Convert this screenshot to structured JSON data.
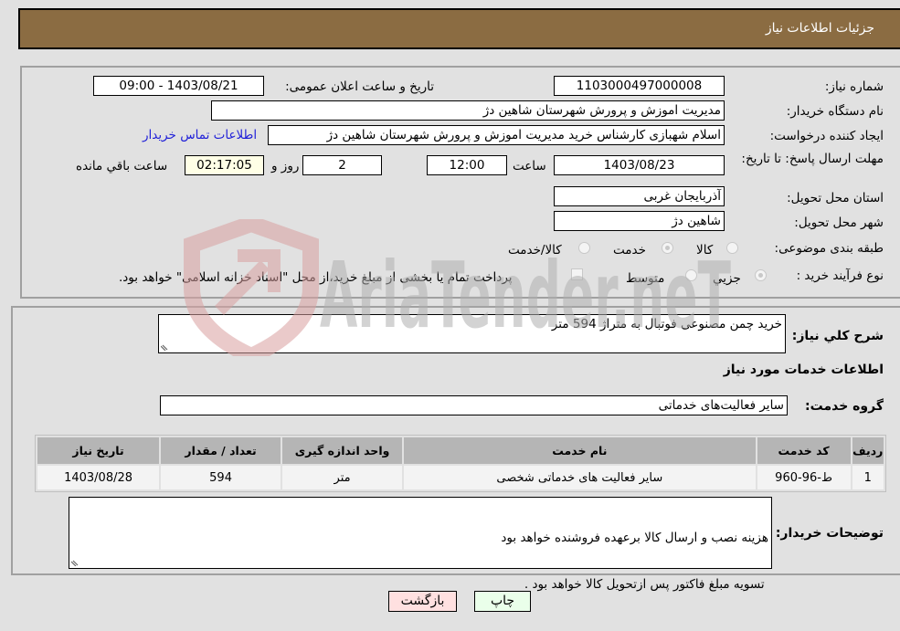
{
  "header": {
    "title": "جزئیات اطلاعات نیاز"
  },
  "details": {
    "need_number_label": "شماره نیاز:",
    "need_number": "1103000497000008",
    "announce_label": "تاریخ و ساعت اعلان عمومی:",
    "announce_value": "1403/08/21 - 09:00",
    "buyer_org_label": "نام دستگاه خریدار:",
    "buyer_org": "مدیریت اموزش و پرورش شهرستان شاهین دژ",
    "creator_label": "ایجاد کننده درخواست:",
    "creator": "اسلام شهبازی کارشناس خرید مدیریت اموزش و پرورش شهرستان شاهین دژ",
    "contact_link": "اطلاعات تماس خریدار",
    "deadline_label": "مهلت ارسال پاسخ: تا تاریخ:",
    "deadline_date": "1403/08/23",
    "time_label": "ساعت",
    "deadline_time": "12:00",
    "days_value": "2",
    "days_label": "روز و",
    "remaining_time": "02:17:05",
    "remaining_label": "ساعت باقي مانده",
    "province_label": "استان محل تحویل:",
    "province": "آذربایجان غربی",
    "city_label": "شهر محل تحویل:",
    "city": "شاهین دژ",
    "category_label": "طبقه بندی موضوعی:",
    "category_options": [
      {
        "label": "کالا",
        "selected": false
      },
      {
        "label": "خدمت",
        "selected": true
      },
      {
        "label": "کالا/خدمت",
        "selected": false
      }
    ],
    "process_label": "نوع فرآیند خرید :",
    "process_options": [
      {
        "label": "جزيي",
        "selected": true
      },
      {
        "label": "متوسط",
        "selected": false
      }
    ],
    "treasury_note": "پرداخت تمام یا بخشی از مبلغ خرید،از محل \"اسناد خزانه اسلامی\" خواهد بود."
  },
  "need": {
    "summary_label": "شرح كلي نياز:",
    "summary": "خرید چمن مصنوعی فوتبال به متراژ 594 متر",
    "services_heading": "اطلاعات خدمات مورد نیاز",
    "group_label": "گروه خدمت:",
    "group": "سایر فعالیت‌های خدماتی"
  },
  "table": {
    "headers": [
      "ردیف",
      "کد خدمت",
      "نام خدمت",
      "واحد اندازه گیری",
      "تعداد / مقدار",
      "تاریخ نیاز"
    ],
    "rows": [
      [
        "1",
        "ط-96-960",
        "سایر فعالیت های خدماتی شخصی",
        "متر",
        "594",
        "1403/08/28"
      ]
    ]
  },
  "buyer_notes": {
    "label": "توضیحات خریدار:",
    "line1": "هزینه نصب و ارسال کالا برعهده فروشنده خواهد بود",
    "line2": " تسویه مبلغ فاکتور پس ازتحویل کالا خواهد بود ."
  },
  "buttons": {
    "print": "چاپ",
    "back": "بازگشت"
  },
  "watermark": {
    "text": "AriaTender.neT"
  }
}
